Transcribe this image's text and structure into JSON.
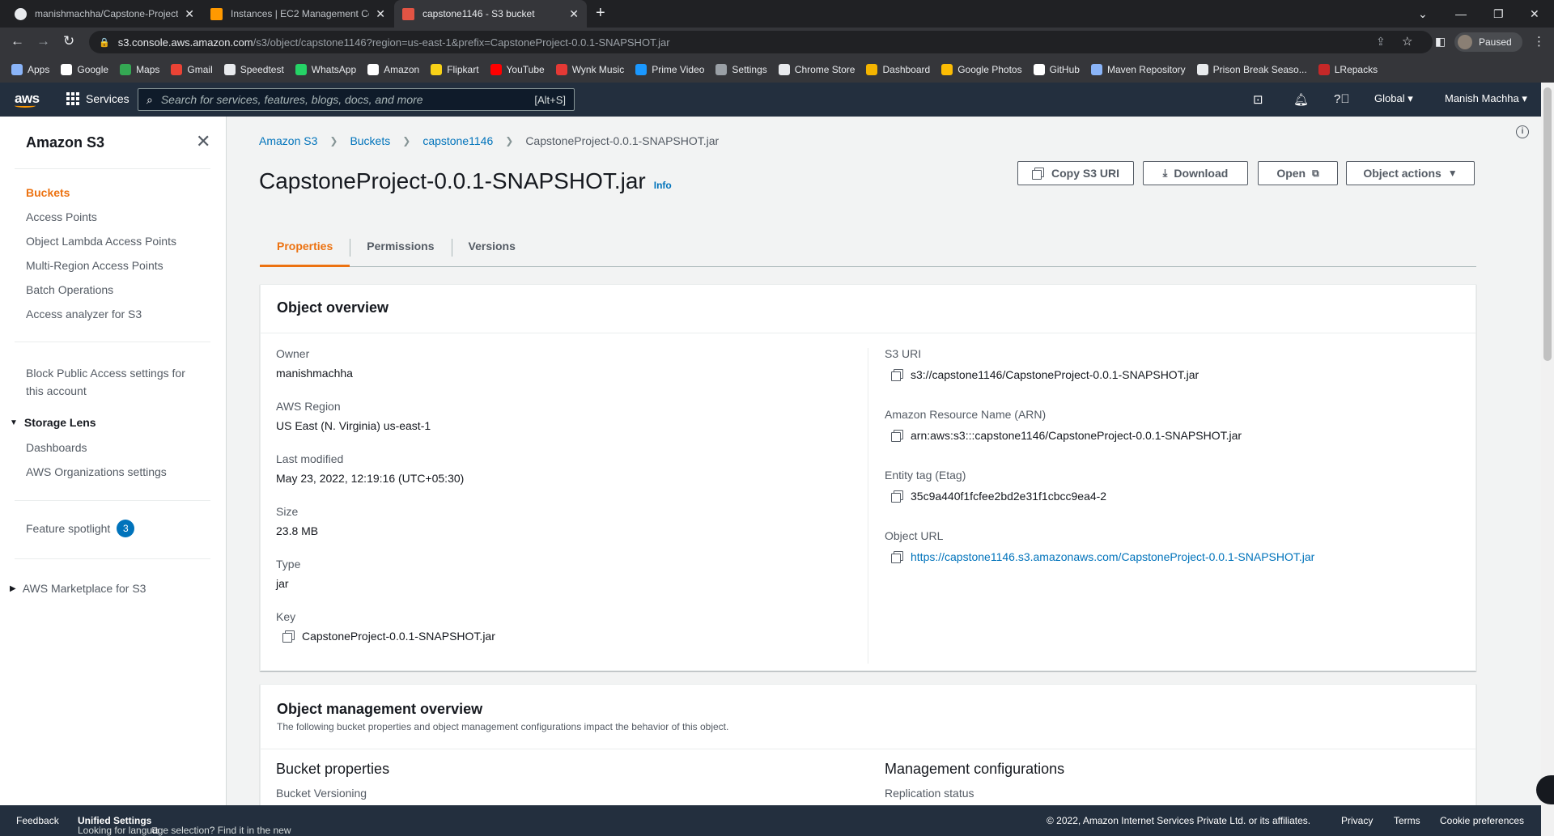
{
  "browser": {
    "tabs": [
      {
        "label": "manishmachha/Capstone-Project",
        "favicon_color": "#e8eaed"
      },
      {
        "label": "Instances | EC2 Management Co",
        "favicon_color": "#ff9900"
      },
      {
        "label": "capstone1146 - S3 bucket",
        "favicon_color": "#e25444"
      }
    ],
    "url_host": "s3.console.aws.amazon.com",
    "url_rest": "/s3/object/capstone1146?region=us-east-1&prefix=CapstoneProject-0.0.1-SNAPSHOT.jar",
    "profile_status": "Paused",
    "bookmarks": [
      {
        "label": "Apps",
        "color": "#8ab4f8"
      },
      {
        "label": "Google",
        "color": "#ffffff"
      },
      {
        "label": "Maps",
        "color": "#34a853"
      },
      {
        "label": "Gmail",
        "color": "#ea4335"
      },
      {
        "label": "Speedtest",
        "color": "#e8eaed"
      },
      {
        "label": "WhatsApp",
        "color": "#25d366"
      },
      {
        "label": "Amazon",
        "color": "#ffffff"
      },
      {
        "label": "Flipkart",
        "color": "#f7d117"
      },
      {
        "label": "YouTube",
        "color": "#ff0000"
      },
      {
        "label": "Wynk Music",
        "color": "#e53935"
      },
      {
        "label": "Prime Video",
        "color": "#1a98ff"
      },
      {
        "label": "Settings",
        "color": "#9aa0a6"
      },
      {
        "label": "Chrome Store",
        "color": "#e8eaed"
      },
      {
        "label": "Dashboard",
        "color": "#f4b400"
      },
      {
        "label": "Google Photos",
        "color": "#fbbc04"
      },
      {
        "label": "GitHub",
        "color": "#ffffff"
      },
      {
        "label": "Maven Repository",
        "color": "#8ab4f8"
      },
      {
        "label": "Prison Break Seaso...",
        "color": "#e8eaed"
      },
      {
        "label": "LRepacks",
        "color": "#c62828"
      }
    ]
  },
  "aws_nav": {
    "logo": "aws",
    "services": "Services",
    "search_placeholder": "Search for services, features, blogs, docs, and more",
    "search_shortcut": "[Alt+S]",
    "region": "Global",
    "user": "Manish Machha"
  },
  "sidebar": {
    "title": "Amazon S3",
    "links": [
      "Buckets",
      "Access Points",
      "Object Lambda Access Points",
      "Multi-Region Access Points",
      "Batch Operations",
      "Access analyzer for S3"
    ],
    "block_public_line1": "Block Public Access settings for",
    "block_public_line2": "this account",
    "storage_lens": "Storage Lens",
    "storage_lens_links": [
      "Dashboards",
      "AWS Organizations settings"
    ],
    "feature_spotlight": "Feature spotlight",
    "feature_spotlight_count": "3",
    "marketplace": "AWS Marketplace for S3"
  },
  "breadcrumb": [
    "Amazon S3",
    "Buckets",
    "capstone1146",
    "CapstoneProject-0.0.1-SNAPSHOT.jar"
  ],
  "page": {
    "title": "CapstoneProject-0.0.1-SNAPSHOT.jar",
    "info": "Info",
    "buttons": {
      "copy_uri": "Copy S3 URI",
      "download": "Download",
      "open": "Open",
      "object_actions": "Object actions"
    },
    "tabs": [
      "Properties",
      "Permissions",
      "Versions"
    ]
  },
  "overview": {
    "title": "Object overview",
    "left": [
      {
        "key": "Owner",
        "value": "manishmachha"
      },
      {
        "key": "AWS Region",
        "value": "US East (N. Virginia) us-east-1"
      },
      {
        "key": "Last modified",
        "value": "May 23, 2022, 12:19:16 (UTC+05:30)"
      },
      {
        "key": "Size",
        "value": "23.8 MB"
      },
      {
        "key": "Type",
        "value": "jar"
      },
      {
        "key": "Key",
        "value": "CapstoneProject-0.0.1-SNAPSHOT.jar"
      }
    ],
    "right": [
      {
        "key": "S3 URI",
        "value": "s3://capstone1146/CapstoneProject-0.0.1-SNAPSHOT.jar"
      },
      {
        "key": "Amazon Resource Name (ARN)",
        "value": "arn:aws:s3:::capstone1146/CapstoneProject-0.0.1-SNAPSHOT.jar"
      },
      {
        "key": "Entity tag (Etag)",
        "value": "35c9a440f1fcfee2bd2e31f1cbcc9ea4-2"
      },
      {
        "key": "Object URL",
        "value": "https://capstone1146.s3.amazonaws.com/CapstoneProject-0.0.1-SNAPSHOT.jar"
      }
    ]
  },
  "management": {
    "title": "Object management overview",
    "subtitle": "The following bucket properties and object management configurations impact the behavior of this object.",
    "bucket_properties": "Bucket properties",
    "bucket_versioning": "Bucket Versioning",
    "management_configurations": "Management configurations",
    "replication_status": "Replication status"
  },
  "footer": {
    "feedback": "Feedback",
    "language_note": "Looking for language selection? Find it in the new",
    "unified_settings": "Unified Settings",
    "copyright": "© 2022, Amazon Internet Services Private Ltd. or its affiliates.",
    "privacy": "Privacy",
    "terms": "Terms",
    "cookies": "Cookie preferences"
  }
}
